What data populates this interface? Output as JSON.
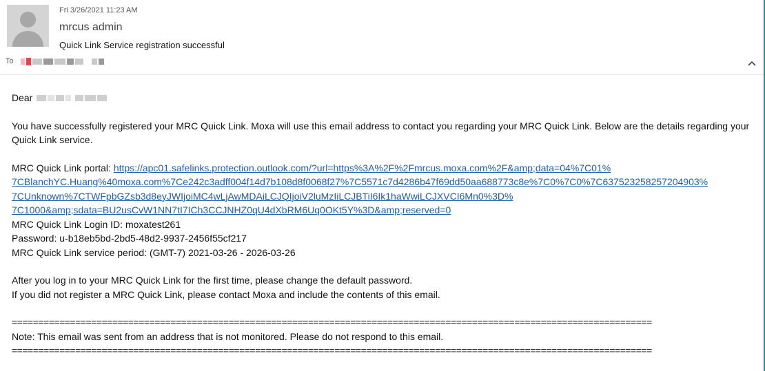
{
  "header": {
    "datetime": "Fri 3/26/2021 11:23 AM",
    "sender": "mrcus admin",
    "subject": "Quick Link Service registration successful",
    "to_label": "To"
  },
  "body": {
    "greeting": "Dear",
    "intro": "You have successfully registered your MRC Quick Link. Moxa will use this email address to contact you regarding your MRC Quick Link. Below are the details regarding your Quick Link service.",
    "portal_label": "MRC Quick Link portal: ",
    "portal_link_lines": [
      "https://apc01.safelinks.protection.outlook.com/?url=https%3A%2F%2Fmrcus.moxa.com%2F&amp;data=04%7C01%",
      "7CBlanchYC.Huang%40moxa.com%7Ce242c3adff004f14d7b108d8f0068f27%7C5571c7d4286b47f69dd50aa688773c8e%7C0%7C0%7C637523258257204903%",
      "7CUnknown%7CTWFpbGZsb3d8eyJWIjoiMC4wLjAwMDAiLCJQIjoiV2luMzIiLCJBTiI6Ik1haWwiLCJXVCI6Mn0%3D%",
      "7C1000&amp;sdata=BU2usCvW1NN7tI7ICh3CCJNHZ0qU4dXbRM6Uq0OKt5Y%3D&amp;reserved=0"
    ],
    "login_id": "MRC Quick Link Login ID: moxatest261",
    "password": "Password: u-b18eb5bd-2bd5-48d2-9937-2456f55cf217",
    "service_period": "MRC Quick Link service period: (GMT-7) 2021-03-26 - 2026-03-26",
    "change_password": "After you log in to your MRC Quick Link for the first time, please change the default password.",
    "not_registered": "If you did not register a MRC Quick Link, please contact Moxa and include the contents of this email.",
    "divider": "=========================================================================================================================",
    "note": "Note: This email was sent from an address that is not monitored. Please do not respond to this email."
  },
  "icons": {
    "avatar": "person-avatar-icon",
    "collapse": "chevron-up-icon"
  },
  "colors": {
    "link": "#1a5fb4",
    "accent_border": "#1f8a9c",
    "redaction_red": "#e0474c"
  }
}
